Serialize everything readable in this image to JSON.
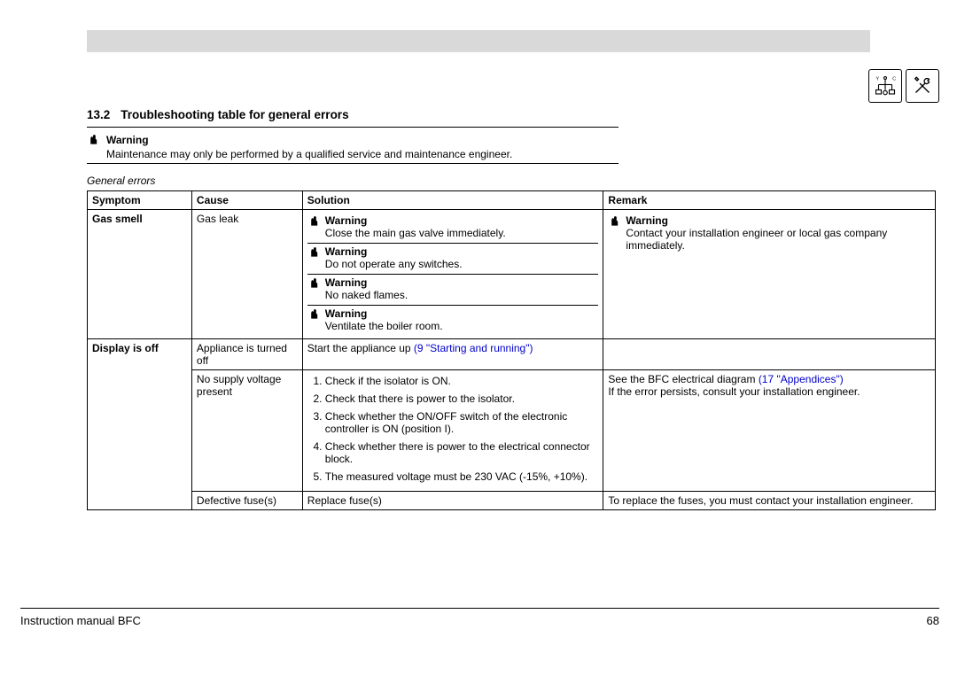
{
  "header": {
    "bar": ""
  },
  "section": {
    "number": "13.2",
    "title": "Troubleshooting table for general errors"
  },
  "topwarning": {
    "label": "Warning",
    "text": "Maintenance may only be performed by a qualified service and maintenance engineer."
  },
  "table": {
    "caption": "General errors",
    "headers": {
      "symptom": "Symptom",
      "cause": "Cause",
      "solution": "Solution",
      "remark": "Remark"
    },
    "rows": {
      "r1": {
        "symptom": "Gas smell",
        "cause": "Gas leak",
        "warn1_label": "Warning",
        "warn1_text": "Close the main gas valve immediately.",
        "warn2_label": "Warning",
        "warn2_text": "Do not operate any switches.",
        "warn3_label": "Warning",
        "warn3_text": "No naked flames.",
        "warn4_label": "Warning",
        "warn4_text": "Ventilate the boiler room.",
        "remark_label": "Warning",
        "remark_text": "Contact your installation engineer or local gas company immediately."
      },
      "r2": {
        "symptom": "Display is off",
        "cause": "Appliance is turned off",
        "solution_pre": "Start the appliance up ",
        "solution_link": "(9 \"Starting and running\")"
      },
      "r3": {
        "cause": "No supply voltage present",
        "steps": {
          "s1": "Check if the isolator is ON.",
          "s2": "Check that there is power to the isolator.",
          "s3": "Check whether the ON/OFF switch of the electronic controller is ON (position I).",
          "s4": "Check whether there is power to the electrical connector block.",
          "s5": "The measured voltage must be 230 VAC (-15%, +10%)."
        },
        "remark_pre": "See the BFC electrical diagram ",
        "remark_link": "(17 \"Appendices\")",
        "remark_post": "If the error persists, consult your installation engineer."
      },
      "r4": {
        "cause": "Defective fuse(s)",
        "solution": "Replace fuse(s)",
        "remark": "To replace the fuses, you must contact your installation engineer."
      }
    }
  },
  "footer": {
    "left": "Instruction manual BFC",
    "page": "68"
  }
}
